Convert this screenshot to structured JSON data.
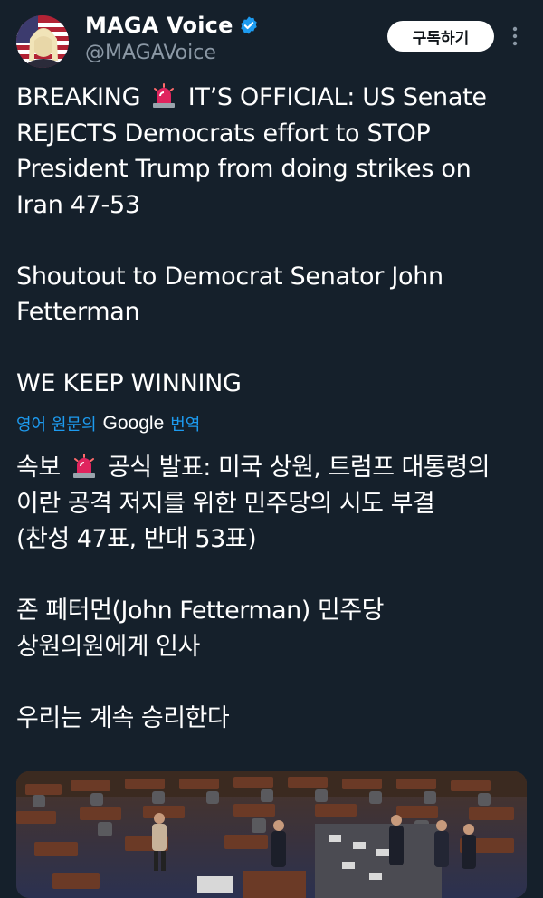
{
  "author": {
    "display_name": "MAGA Voice",
    "handle": "@MAGAVoice"
  },
  "subscribe_label": "구독하기",
  "tweet": {
    "line1_a": "BREAKING ",
    "line1_b": " IT’S OFFICIAL: US Senate\nREJECTS Democrats effort to STOP\nPresident Trump from doing strikes on\nIran 47-53\n\nShoutout to Democrat Senator John\nFetterman\n\nWE KEEP WINNING"
  },
  "translation": {
    "prefix": "영어 원문의",
    "provider": "Google",
    "suffix": "번역",
    "text_a": "속보 ",
    "text_b": " 공식 발표: 미국 상원, 트럼프 대통령의\n이란 공격 저지를 위한 민주당의 시도 부결\n(찬성 47표, 반대 53표)\n\n존 페터먼(John Fetterman) 민주당\n상원의원에게 인사\n\n우리는 계속 승리한다"
  },
  "icons": {
    "verified": "verified-badge-icon",
    "more": "more-vertical-icon",
    "siren": "police-siren-emoji"
  },
  "colors": {
    "background": "#15202b",
    "link": "#1d9bf0",
    "secondary_text": "#8b98a5",
    "verified": "#1d9bf0"
  }
}
